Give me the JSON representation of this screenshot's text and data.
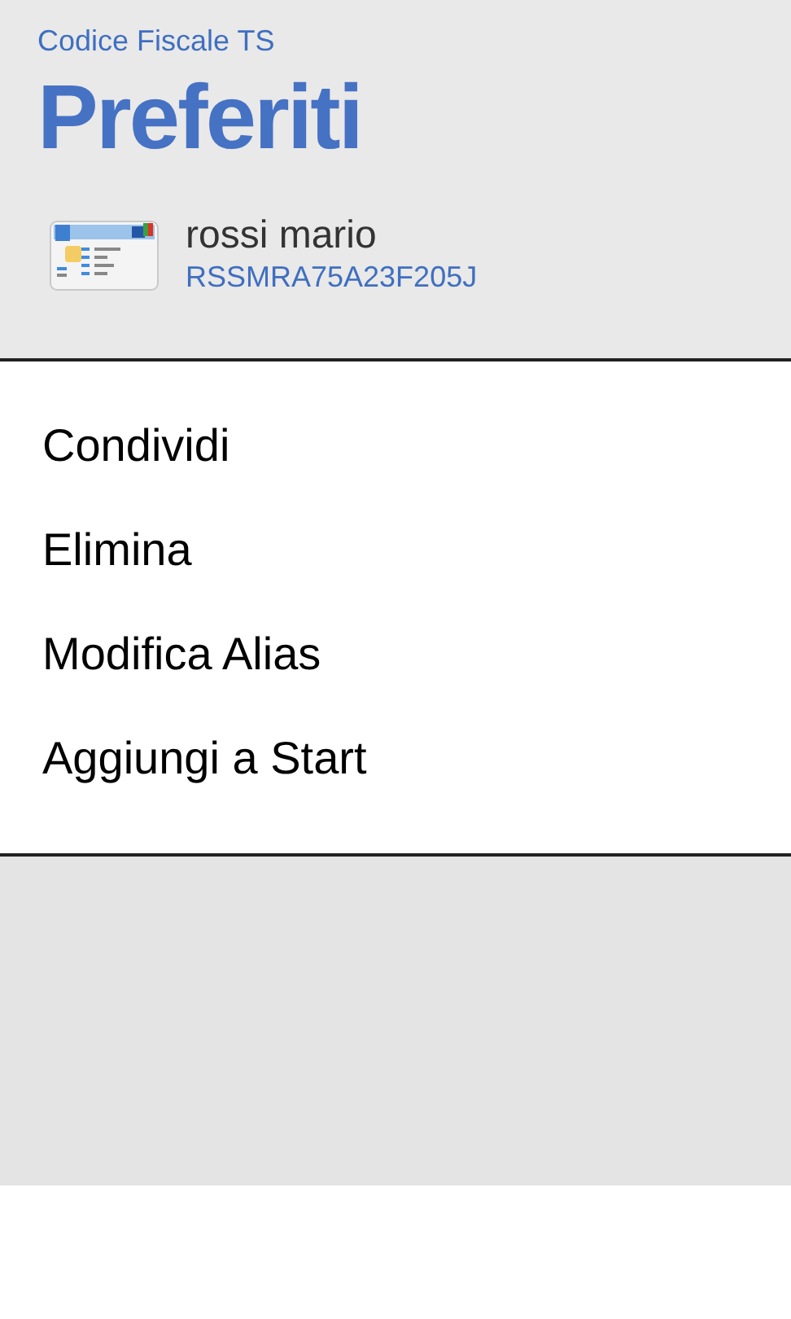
{
  "app_title": "Codice Fiscale TS",
  "page_title": "Preferiti",
  "entry": {
    "name": "rossi mario",
    "code": "RSSMRA75A23F205J"
  },
  "menu": [
    {
      "label": "Condividi"
    },
    {
      "label": "Elimina"
    },
    {
      "label": "Modifica Alias"
    },
    {
      "label": "Aggiungi a Start"
    }
  ]
}
